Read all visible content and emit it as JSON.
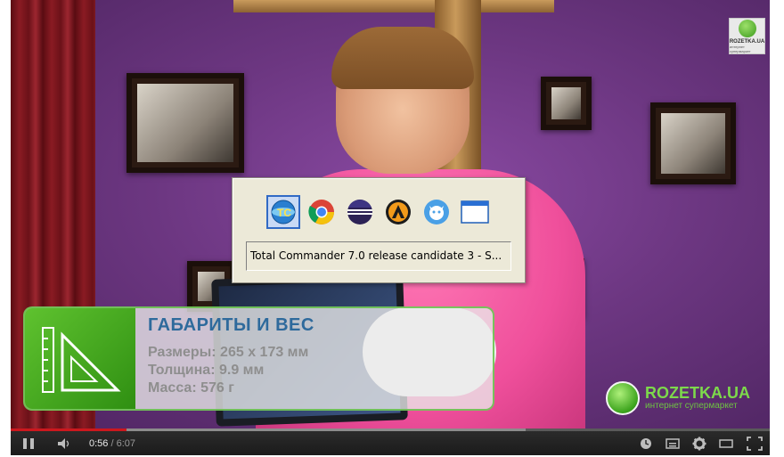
{
  "switcher": {
    "icons": [
      "total-commander-icon",
      "chrome-icon",
      "eclipse-icon",
      "aimp-icon",
      "owl-app-icon",
      "window-icon"
    ],
    "selected_index": 0,
    "window_title": "Total Commander 7.0 release candidate 3 - S..."
  },
  "banner": {
    "title": "ГАБАРИТЫ И ВЕС",
    "size_line": "Размеры: 265 х 173 мм",
    "thickness_line": "Толщина: 9.9 мм",
    "weight_line": "Масса: 576 г"
  },
  "logo": {
    "name": "ROZETKA.UA",
    "tagline": "интернет супермаркет"
  },
  "watermark": {
    "name": "ROZETKA.UA",
    "tagline": "интернет супермаркет"
  },
  "player": {
    "current_time": "0:56",
    "separator": " / ",
    "duration": "6:07",
    "played_fraction": 0.153,
    "buffered_fraction": 0.678
  },
  "colors": {
    "accent_red": "#cc181e",
    "banner_title": "#2e6a9c",
    "brand_green": "#5fc22f"
  }
}
